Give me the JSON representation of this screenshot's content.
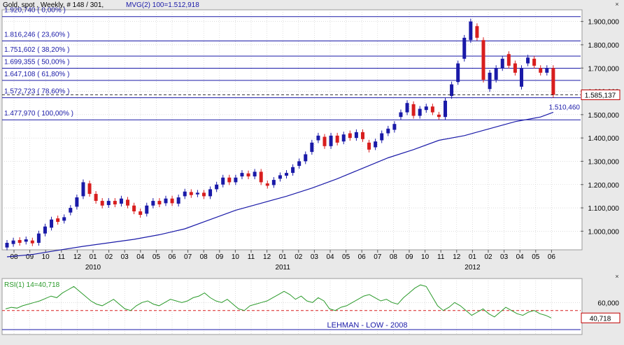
{
  "header": {
    "title": "Gold, spot , Weekly, # 148 / 301,",
    "indicator": "MVG(2) 100=1.512,918"
  },
  "colors": {
    "background": "#ffffff",
    "frame": "#e9e9e9",
    "grid": "#c8c8c8",
    "fib_line": "#1a1aa8",
    "moving_average": "#1a1aa8",
    "candle_up": "#1a1aa8",
    "candle_down": "#d81e1e",
    "rsi_line": "#2a9a2a",
    "text_blue": "#1a1aa8",
    "current_price": "#c00000"
  },
  "chart_data": [
    {
      "type": "candlestick",
      "title": "Gold, spot , Weekly",
      "xlabel": "",
      "ylabel": "",
      "ylim": [
        920000,
        1950000
      ],
      "y_ticks": [
        1000000,
        1100000,
        1200000,
        1300000,
        1400000,
        1500000,
        1600000,
        1700000,
        1800000,
        1900000
      ],
      "y_tick_labels": [
        "1.000,000",
        "1.100,000",
        "1.200,000",
        "1.300,000",
        "1.400,000",
        "1.500,000",
        "1.600,000",
        "1.700,000",
        "1.800,000",
        "1.900,000"
      ],
      "x_month_labels": [
        "08",
        "09",
        "10",
        "11",
        "12",
        "01",
        "02",
        "03",
        "04",
        "05",
        "06",
        "07",
        "08",
        "09",
        "10",
        "11",
        "12",
        "01",
        "02",
        "03",
        "04",
        "05",
        "06",
        "07",
        "08",
        "09",
        "10",
        "11",
        "12",
        "01",
        "02",
        "03",
        "04",
        "05",
        "06"
      ],
      "x_year_labels": [
        {
          "label": "2010",
          "month_index": 5
        },
        {
          "label": "2011",
          "month_index": 17
        },
        {
          "label": "2012",
          "month_index": 29
        }
      ],
      "fib_levels": [
        {
          "label": "1.920,740 ( 0,00% )",
          "value": 1920740
        },
        {
          "label": "1.816,246 ( 23,60% )",
          "value": 1816246
        },
        {
          "label": "1.751,602 ( 38,20% )",
          "value": 1751602
        },
        {
          "label": "1.699,355 ( 50,00% )",
          "value": 1699355
        },
        {
          "label": "1.647,108 ( 61,80% )",
          "value": 1647108
        },
        {
          "label": "1.572,723 ( 78,60% )",
          "value": 1572723
        },
        {
          "label": "1.477,970 ( 100,00% )",
          "value": 1477970
        }
      ],
      "current_price": {
        "label": "1.585,137",
        "value": 1585137
      },
      "moving_average": {
        "name": "MVG(2) 100",
        "label": "1.510,460",
        "points": [
          [
            0,
            890000
          ],
          [
            4,
            900000
          ],
          [
            8,
            918000
          ],
          [
            12,
            935000
          ],
          [
            16,
            950000
          ],
          [
            20,
            965000
          ],
          [
            24,
            985000
          ],
          [
            28,
            1010000
          ],
          [
            32,
            1050000
          ],
          [
            36,
            1090000
          ],
          [
            40,
            1120000
          ],
          [
            44,
            1150000
          ],
          [
            48,
            1185000
          ],
          [
            52,
            1225000
          ],
          [
            56,
            1270000
          ],
          [
            60,
            1315000
          ],
          [
            64,
            1350000
          ],
          [
            68,
            1390000
          ],
          [
            72,
            1410000
          ],
          [
            76,
            1440000
          ],
          [
            80,
            1470000
          ],
          [
            84,
            1490000
          ],
          [
            86,
            1510460
          ]
        ]
      },
      "candles": [
        [
          0,
          930000,
          950000
        ],
        [
          1,
          945000,
          960000
        ],
        [
          2,
          962000,
          950000
        ],
        [
          3,
          955000,
          965000
        ],
        [
          4,
          960000,
          948000
        ],
        [
          5,
          950000,
          990000
        ],
        [
          6,
          990000,
          1020000
        ],
        [
          7,
          1015000,
          1050000
        ],
        [
          8,
          1055000,
          1040000
        ],
        [
          9,
          1045000,
          1060000
        ],
        [
          10,
          1080000,
          1100000
        ],
        [
          11,
          1105000,
          1145000
        ],
        [
          12,
          1150000,
          1210000
        ],
        [
          13,
          1205000,
          1160000
        ],
        [
          14,
          1160000,
          1130000
        ],
        [
          15,
          1130000,
          1110000
        ],
        [
          16,
          1112000,
          1130000
        ],
        [
          17,
          1130000,
          1115000
        ],
        [
          18,
          1118000,
          1140000
        ],
        [
          19,
          1135000,
          1110000
        ],
        [
          20,
          1110000,
          1085000
        ],
        [
          21,
          1085000,
          1070000
        ],
        [
          22,
          1075000,
          1110000
        ],
        [
          23,
          1110000,
          1130000
        ],
        [
          24,
          1130000,
          1115000
        ],
        [
          25,
          1120000,
          1140000
        ],
        [
          26,
          1140000,
          1120000
        ],
        [
          27,
          1118000,
          1145000
        ],
        [
          28,
          1150000,
          1170000
        ],
        [
          29,
          1168000,
          1155000
        ],
        [
          30,
          1158000,
          1165000
        ],
        [
          31,
          1165000,
          1150000
        ],
        [
          32,
          1150000,
          1180000
        ],
        [
          33,
          1180000,
          1200000
        ],
        [
          34,
          1200000,
          1230000
        ],
        [
          35,
          1230000,
          1210000
        ],
        [
          36,
          1210000,
          1230000
        ],
        [
          37,
          1235000,
          1250000
        ],
        [
          38,
          1248000,
          1235000
        ],
        [
          39,
          1235000,
          1255000
        ],
        [
          40,
          1255000,
          1210000
        ],
        [
          41,
          1205000,
          1195000
        ],
        [
          42,
          1198000,
          1220000
        ],
        [
          43,
          1225000,
          1240000
        ],
        [
          44,
          1238000,
          1250000
        ],
        [
          45,
          1250000,
          1275000
        ],
        [
          46,
          1280000,
          1300000
        ],
        [
          47,
          1300000,
          1330000
        ],
        [
          48,
          1340000,
          1380000
        ],
        [
          49,
          1390000,
          1410000
        ],
        [
          50,
          1405000,
          1365000
        ],
        [
          51,
          1365000,
          1410000
        ],
        [
          52,
          1410000,
          1380000
        ],
        [
          53,
          1385000,
          1415000
        ],
        [
          54,
          1420000,
          1400000
        ],
        [
          55,
          1400000,
          1425000
        ],
        [
          56,
          1425000,
          1395000
        ],
        [
          57,
          1380000,
          1350000
        ],
        [
          58,
          1360000,
          1385000
        ],
        [
          59,
          1390000,
          1420000
        ],
        [
          60,
          1420000,
          1440000
        ],
        [
          61,
          1435000,
          1460000
        ],
        [
          62,
          1490000,
          1510000
        ],
        [
          63,
          1510000,
          1550000
        ],
        [
          64,
          1545000,
          1495000
        ],
        [
          65,
          1495000,
          1525000
        ],
        [
          66,
          1520000,
          1535000
        ],
        [
          67,
          1535000,
          1510000
        ],
        [
          68,
          1500000,
          1490000
        ],
        [
          69,
          1490000,
          1560000
        ],
        [
          70,
          1580000,
          1630000
        ],
        [
          71,
          1640000,
          1720000
        ],
        [
          72,
          1740000,
          1830000
        ],
        [
          73,
          1820000,
          1900000
        ],
        [
          74,
          1880000,
          1830000
        ],
        [
          75,
          1820000,
          1650000
        ],
        [
          76,
          1610000,
          1680000
        ],
        [
          77,
          1650000,
          1700000
        ],
        [
          78,
          1700000,
          1740000
        ],
        [
          79,
          1760000,
          1710000
        ],
        [
          80,
          1720000,
          1680000
        ],
        [
          81,
          1620000,
          1700000
        ],
        [
          82,
          1720000,
          1745000
        ],
        [
          83,
          1740000,
          1710000
        ],
        [
          84,
          1700000,
          1680000
        ],
        [
          85,
          1680000,
          1700000
        ],
        [
          86,
          1700000,
          1585137
        ]
      ]
    },
    {
      "type": "line",
      "title": "RSI(1) 14=40,718",
      "name": "RSI(1) 14",
      "current_value": 40.718,
      "current_label": "40,718",
      "ylim": [
        20,
        90
      ],
      "y_ticks": [
        60
      ],
      "y_tick_labels": [
        "60,000"
      ],
      "reference_level": 50,
      "annotation": "LEHMAN - LOW - 2008",
      "values": [
        52,
        54,
        53,
        56,
        58,
        60,
        62,
        65,
        68,
        66,
        72,
        76,
        80,
        74,
        68,
        62,
        58,
        56,
        60,
        64,
        58,
        52,
        50,
        56,
        60,
        62,
        58,
        56,
        60,
        64,
        62,
        60,
        62,
        66,
        68,
        72,
        66,
        62,
        60,
        64,
        58,
        52,
        50,
        56,
        58,
        60,
        62,
        66,
        70,
        74,
        70,
        64,
        68,
        62,
        60,
        66,
        62,
        52,
        50,
        54,
        56,
        60,
        64,
        68,
        70,
        66,
        62,
        64,
        60,
        58,
        66,
        72,
        78,
        82,
        80,
        68,
        56,
        50,
        54,
        60,
        56,
        50,
        44,
        48,
        52,
        46,
        42,
        48,
        54,
        50,
        46,
        44,
        48,
        50,
        46,
        44,
        40.718
      ]
    }
  ]
}
